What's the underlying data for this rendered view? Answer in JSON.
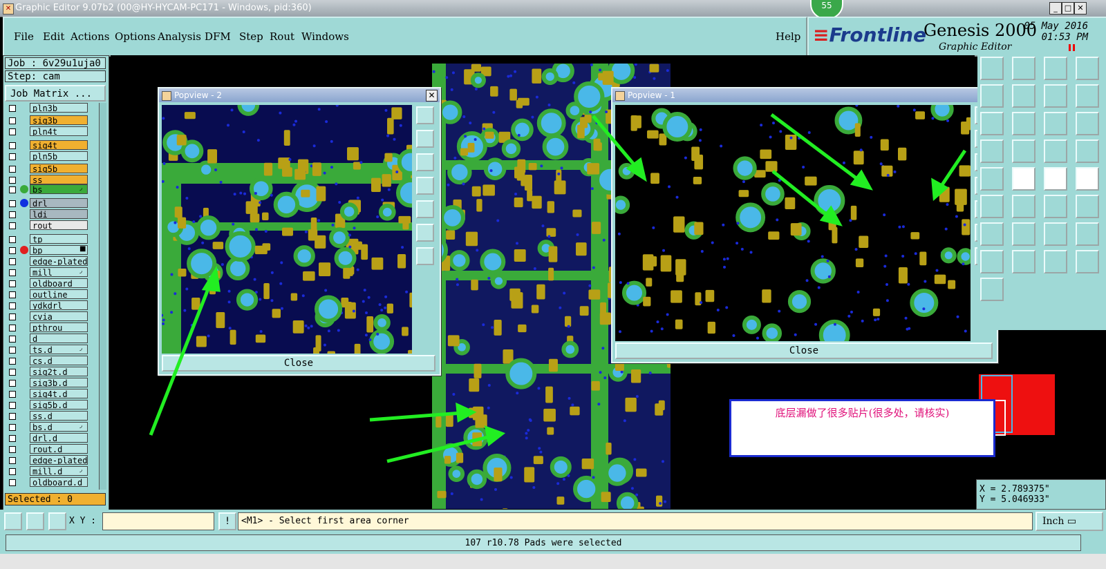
{
  "window": {
    "title": "Graphic Editor 9.07b2 (00@HY-HYCAM-PC171 - Windows, pid:360)",
    "notification_count": "55"
  },
  "menu": {
    "items": [
      "File",
      "Edit",
      "Actions",
      "Options",
      "Analysis",
      "DFM",
      "Step",
      "Rout",
      "Windows"
    ],
    "help": "Help"
  },
  "brand": {
    "logo": "Frontline",
    "product": "Genesis 2000",
    "subtitle": "Graphic Editor",
    "date": "05 May 2016",
    "time": "01:53 PM"
  },
  "job": {
    "job_label": "Job : 6v29u1uja0",
    "step_label": "Step: cam",
    "matrix_button": "Job Matrix ..."
  },
  "layers": [
    {
      "name": "pln3b",
      "color": "#b9e6e4",
      "dot": ""
    },
    {
      "name": "sig3b",
      "color": "#f0b030",
      "dot": ""
    },
    {
      "name": "pln4t",
      "color": "#b9e6e4",
      "dot": ""
    },
    {
      "name": "sig4t",
      "color": "#f0b030",
      "dot": ""
    },
    {
      "name": "pln5b",
      "color": "#b9e6e4",
      "dot": ""
    },
    {
      "name": "sig5b",
      "color": "#f0b030",
      "dot": ""
    },
    {
      "name": "ss",
      "color": "#f0b030",
      "dot": ""
    },
    {
      "name": "bs",
      "color": "#3aaa3a",
      "dot": "#3aaa3a",
      "mark": "◞"
    },
    {
      "name": "drl",
      "color": "#a8b8c0",
      "dot": "#1030e0"
    },
    {
      "name": "ldi",
      "color": "#a8b8c0",
      "dot": ""
    },
    {
      "name": "rout",
      "color": "#e8e8e8",
      "dot": ""
    },
    {
      "name": "tp",
      "color": "#b9e6e4",
      "dot": ""
    },
    {
      "name": "bp",
      "color": "#b9e6e4",
      "dot": "#e02020",
      "mark": "■"
    },
    {
      "name": "edge-plated",
      "color": "#b9e6e4",
      "dot": ""
    },
    {
      "name": "mill",
      "color": "#b9e6e4",
      "dot": "",
      "mark": "◞"
    },
    {
      "name": "oldboard",
      "color": "#b9e6e4",
      "dot": ""
    },
    {
      "name": "outline",
      "color": "#b9e6e4",
      "dot": ""
    },
    {
      "name": "ydkdrl",
      "color": "#b9e6e4",
      "dot": ""
    },
    {
      "name": "cvia",
      "color": "#b9e6e4",
      "dot": ""
    },
    {
      "name": "pthrou",
      "color": "#b9e6e4",
      "dot": ""
    },
    {
      "name": "d",
      "color": "#b9e6e4",
      "dot": ""
    },
    {
      "name": "ts.d",
      "color": "#b9e6e4",
      "dot": "",
      "mark": "◞"
    },
    {
      "name": "cs.d",
      "color": "#b9e6e4",
      "dot": ""
    },
    {
      "name": "sig2t.d",
      "color": "#b9e6e4",
      "dot": ""
    },
    {
      "name": "sig3b.d",
      "color": "#b9e6e4",
      "dot": ""
    },
    {
      "name": "sig4t.d",
      "color": "#b9e6e4",
      "dot": ""
    },
    {
      "name": "sig5b.d",
      "color": "#b9e6e4",
      "dot": ""
    },
    {
      "name": "ss.d",
      "color": "#b9e6e4",
      "dot": ""
    },
    {
      "name": "bs.d",
      "color": "#b9e6e4",
      "dot": "",
      "mark": "◞"
    },
    {
      "name": "drl.d",
      "color": "#b9e6e4",
      "dot": ""
    },
    {
      "name": "rout.d",
      "color": "#b9e6e4",
      "dot": ""
    },
    {
      "name": "edge-plated",
      "color": "#b9e6e4",
      "dot": ""
    },
    {
      "name": "mill.d",
      "color": "#b9e6e4",
      "dot": "",
      "mark": "◞"
    },
    {
      "name": "oldboard.d",
      "color": "#b9e6e4",
      "dot": ""
    }
  ],
  "selected_label": "Selected : 0",
  "popview2": {
    "title": "Popview - 2",
    "close": "Close"
  },
  "popview1": {
    "title": "Popview - 1",
    "close": "Close"
  },
  "note": {
    "text": "底层漏做了很多贴片(很多处，请核实)"
  },
  "coords": {
    "x": "X =  2.789375\"",
    "y": "Y =  5.046933\""
  },
  "bottom": {
    "xy_label": "X Y :",
    "xy_value": "",
    "prompt": "<M1> - Select first area corner",
    "units": "Inch"
  },
  "status": "107 r10.78 Pads were selected",
  "colors": {
    "panel": "#9fd9d6",
    "copper": "#3aaa3a",
    "pad": "#b8a016",
    "drill": "#4ab8e8",
    "via": "#1a2ad8",
    "arrow": "#22ee22"
  }
}
